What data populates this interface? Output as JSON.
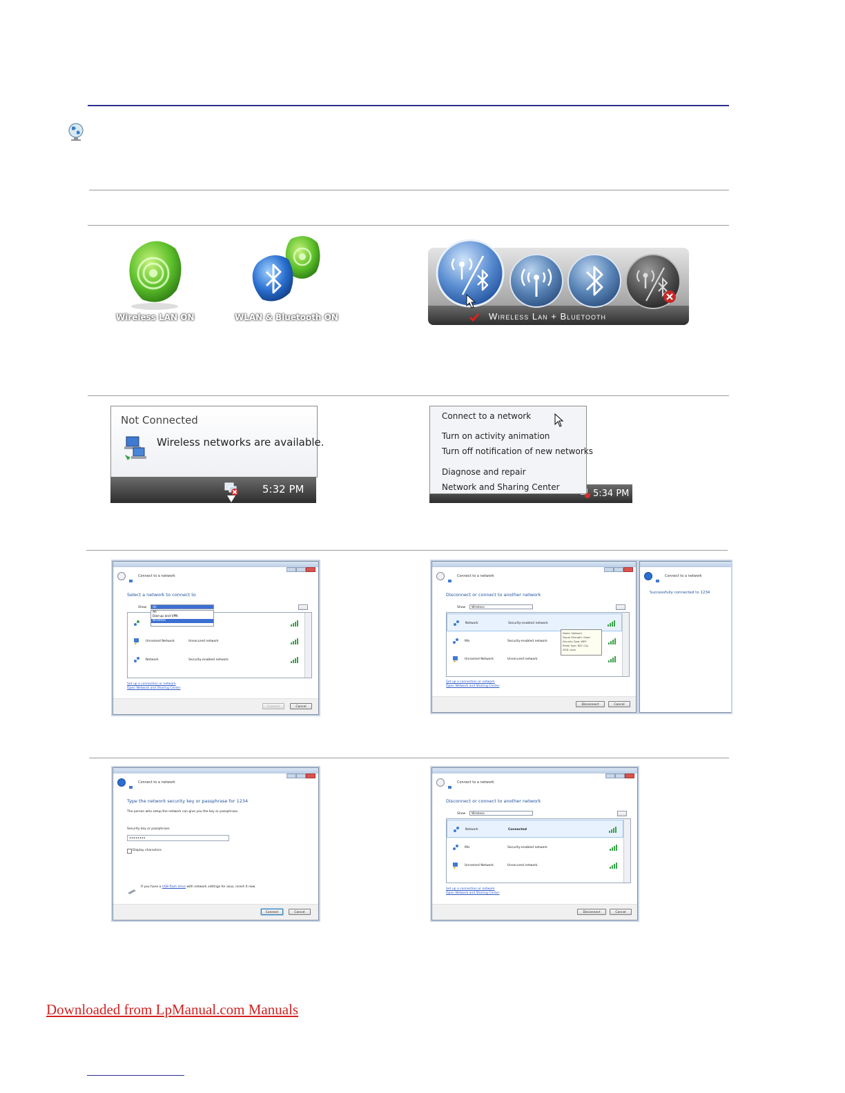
{
  "icons": {
    "wlan_on_label": "Wireless LAN ON",
    "wlan_bt_on_label": "WLAN & Bluetooth ON",
    "osd_label": "Wireless Lan + Bluetooth"
  },
  "tray_notice": {
    "title": "Not Connected",
    "message": "Wireless networks are available.",
    "time": "5:32 PM"
  },
  "tray_menu": {
    "items": [
      "Connect to a network",
      "Turn on activity animation",
      "Turn off notification of new networks",
      "Diagnose and repair",
      "Network and Sharing Center"
    ],
    "time": "5:34 PM"
  },
  "dialog1": {
    "title": "Connect to a network",
    "heading": "Select a network to connect to",
    "show_label": "Show",
    "show_value": "All",
    "dropdown_options": [
      "All",
      "Dial-up and VPN",
      "Wireless"
    ],
    "rows": [
      {
        "name": "Unnamed Network",
        "status": "Unsecured network"
      },
      {
        "name": "Network",
        "status": "Security-enabled network"
      }
    ],
    "row0_suffix": "etwork",
    "links": [
      "Set up a connection or network",
      "Open Network and Sharing Center"
    ],
    "buttons": [
      "Connect",
      "Cancel"
    ]
  },
  "dialog2": {
    "title": "Connect to a network",
    "heading": "Disconnect or connect to another network",
    "show_label": "Show",
    "show_value": "Wireless",
    "rows": [
      {
        "name": "Network",
        "status": "Security-enabled network"
      },
      {
        "name": "Mis",
        "status": "Security-enabled network"
      },
      {
        "name": "Unnamed Network",
        "status": "Unsecured network"
      }
    ],
    "tooltip": [
      "Name: Network",
      "Signal Strength: Good",
      "Security Type: WEP",
      "Radio Type: 802.11g",
      "SSID: asus"
    ],
    "links": [
      "Set up a connection or network",
      "Open Network and Sharing Center"
    ],
    "buttons": [
      "Disconnect",
      "Cancel"
    ]
  },
  "dialog3": {
    "title": "Connect to a network",
    "message": "Successfully connected to 1234"
  },
  "dialog4": {
    "title": "Connect to a network",
    "heading": "Type the network security key or passphrase for 1234",
    "subtext": "The person who setup the network can give you the key or passphrase.",
    "key_label": "Security key or passphrase:",
    "key_value": "••••••••",
    "checkbox_label": "Display characters",
    "usb_prefix": "If you have a ",
    "usb_link": "USB flash drive",
    "usb_suffix": " with network settings for asus, insert it now.",
    "buttons": [
      "Connect",
      "Cancel"
    ]
  },
  "dialog5": {
    "title": "Connect to a network",
    "heading": "Disconnect or connect to another network",
    "show_label": "Show",
    "show_value": "Wireless",
    "rows": [
      {
        "name": "Network",
        "status": "Connected"
      },
      {
        "name": "Mis",
        "status": "Security-enabled network"
      },
      {
        "name": "Unnamed Network",
        "status": "Unsecured network"
      }
    ],
    "links": [
      "Set up a connection or network",
      "Open Network and Sharing Center"
    ],
    "buttons": [
      "Disconnect",
      "Cancel"
    ]
  },
  "footer": {
    "download_link": "Downloaded from LpManual.com Manuals"
  },
  "colors": {
    "accent_rule": "#2a2f8f",
    "link_red": "#d22020",
    "osd_text": "#ffffff"
  }
}
